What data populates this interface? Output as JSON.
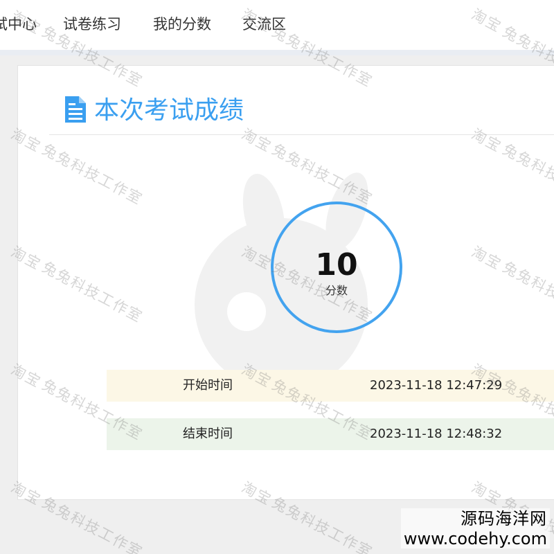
{
  "nav": {
    "items": [
      {
        "label": "试中心"
      },
      {
        "label": "试卷练习"
      },
      {
        "label": "我的分数"
      },
      {
        "label": "交流区"
      }
    ]
  },
  "page": {
    "title": "本次考试成绩"
  },
  "score": {
    "value": "10",
    "label": "分数"
  },
  "times": {
    "start_label": "开始时间",
    "start_value": "2023-11-18 12:47:29",
    "end_label": "结束时间",
    "end_value": "2023-11-18 12:48:32"
  },
  "watermark": {
    "line1": "淘宝",
    "line2": "兔兔科技工作室"
  },
  "stamp": {
    "line1": "源码海洋网",
    "line2": "www.codehy.com"
  },
  "colors": {
    "accent": "#3a9ff0",
    "ring": "#43a3ef",
    "start_row_bg": "#fcf7e6",
    "end_row_bg": "#ecf4ea"
  },
  "icons": {
    "title": "document-icon",
    "background": "rabbit-mascot-icon"
  }
}
